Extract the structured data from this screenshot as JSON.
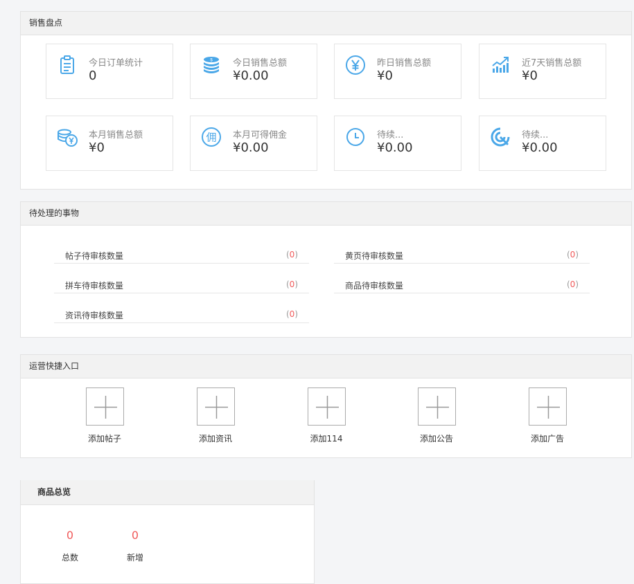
{
  "colors": {
    "accent": "#4aa7e8",
    "danger": "#f05a5a",
    "panel_head": "#f2f2f2"
  },
  "sales": {
    "title": "销售盘点",
    "cards": [
      {
        "icon": "clipboard-icon",
        "label": "今日订单统计",
        "value": "0"
      },
      {
        "icon": "coin-stack-icon",
        "label": "今日销售总额",
        "value": "¥0.00"
      },
      {
        "icon": "yen-circle-icon",
        "label": "昨日销售总额",
        "value": "¥0"
      },
      {
        "icon": "trend-chart-icon",
        "label": "近7天销售总额",
        "value": "¥0"
      },
      {
        "icon": "coins-yen-icon",
        "label": "本月销售总额",
        "value": "¥0"
      },
      {
        "icon": "commission-icon",
        "label": "本月可得佣金",
        "value": "¥0.00"
      },
      {
        "icon": "clock-icon",
        "label": "待续...",
        "value": "¥0.00"
      },
      {
        "icon": "target-icon",
        "label": "待续...",
        "value": "¥0.00"
      }
    ]
  },
  "pending": {
    "title": "待处理的事物",
    "items": [
      {
        "label": "帖子待审核数量",
        "count": "0"
      },
      {
        "label": "黄页待审核数量",
        "count": "0"
      },
      {
        "label": "拼车待审核数量",
        "count": "0"
      },
      {
        "label": "商品待审核数量",
        "count": "0"
      },
      {
        "label": "资讯待审核数量",
        "count": "0"
      }
    ]
  },
  "quick": {
    "title": "运营快捷入口",
    "items": [
      {
        "label": "添加帖子"
      },
      {
        "label": "添加资讯"
      },
      {
        "label": "添加114"
      },
      {
        "label": "添加公告"
      },
      {
        "label": "添加广告"
      }
    ]
  },
  "goods": {
    "title": "商品总览",
    "stats": [
      {
        "value": "0",
        "label": "总数"
      },
      {
        "value": "0",
        "label": "新增"
      }
    ]
  }
}
